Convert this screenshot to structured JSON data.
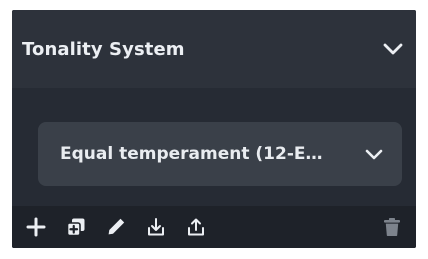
{
  "panel": {
    "title": "Tonality System",
    "header_icon": "chevron-down-icon"
  },
  "tuning_select": {
    "selected_value": "Equal temperament (12-E…",
    "icon": "chevron-down-icon"
  },
  "toolbar": {
    "icons": [
      "plus-icon",
      "duplicate-icon",
      "pencil-icon",
      "import-icon",
      "export-icon",
      "trash-icon"
    ]
  },
  "colors": {
    "header_bg": "#2d323b",
    "panel_bg": "#262b34",
    "field_bg": "#3a4049",
    "toolbar_bg": "#1e2229",
    "text": "#eceff3",
    "disabled_icon": "#7d838c"
  }
}
